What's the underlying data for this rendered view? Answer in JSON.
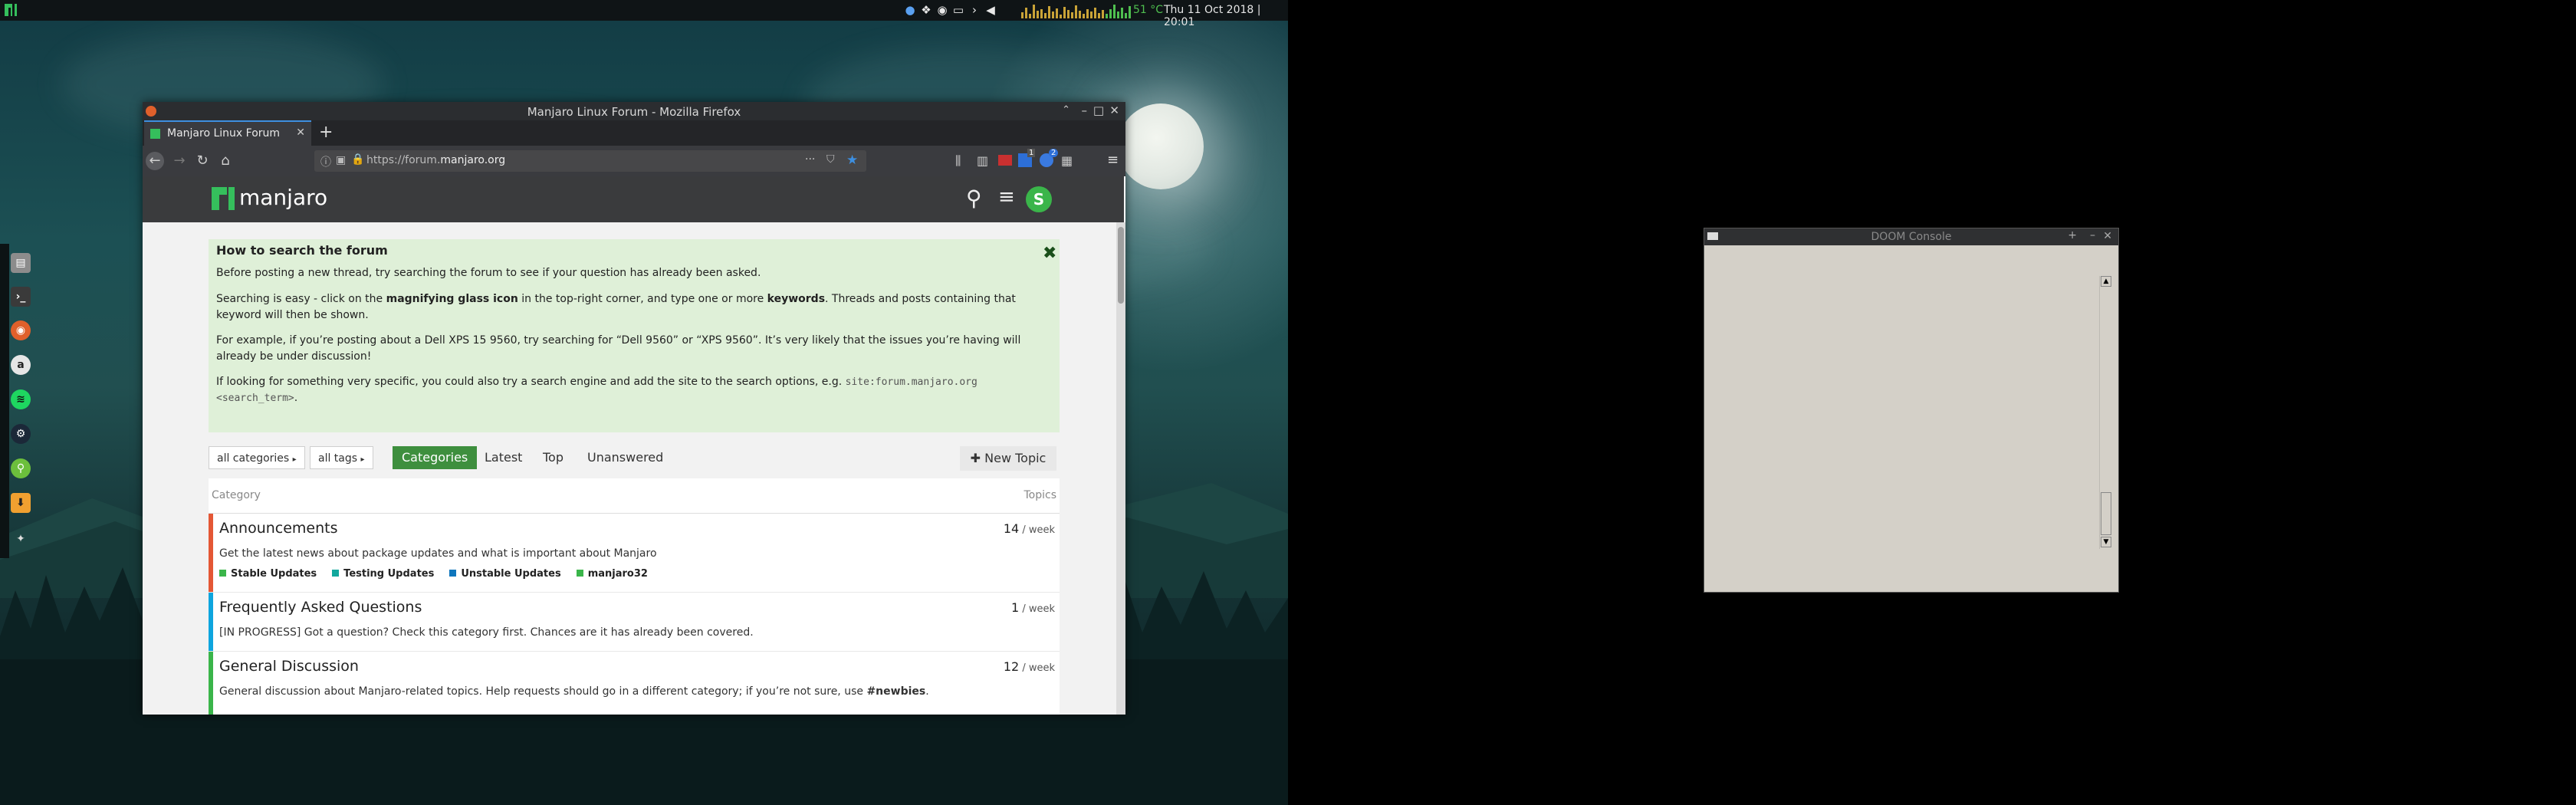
{
  "topbar": {
    "temperature": "51 °C",
    "clock": "Thu 11 Oct 2018 | 20:01"
  },
  "dock": {
    "icons": [
      "file-manager-icon",
      "terminal-icon",
      "firefox-icon",
      "amazon-icon",
      "spotify-icon",
      "steam-icon",
      "keepass-icon",
      "download-icon",
      "settings-icon"
    ]
  },
  "firefox": {
    "window_title": "Manjaro Linux Forum - Mozilla Firefox",
    "tab_title": "Manjaro Linux Forum",
    "new_tab": "+",
    "url_prefix": "https://forum.",
    "url_domain": "manjaro.org",
    "url_more": "···",
    "badge_count": "2",
    "badge_other": "1"
  },
  "forum": {
    "logo_text": "manjaro",
    "avatar_letter": "S",
    "banner": {
      "title": "How to search the forum",
      "p1": "Before posting a new thread, try searching the forum to see if your question has already been asked.",
      "p2_a": "Searching is easy - click on the ",
      "p2_b": "magnifying glass icon",
      "p2_c": " in the top-right corner, and type one or more ",
      "p2_d": "keywords",
      "p2_e": ". Threads and posts containing that keyword will then be shown.",
      "p3": "For example, if you’re posting about a Dell XPS 15 9560, try searching for “Dell 9560” or “XPS 9560”. It’s very likely that the issues you’re having will already be under discussion!",
      "p4_a": "If looking for something very specific, you could also try a search engine and add the site to the search options, e.g. ",
      "p4_code1": "site:forum.manjaro.org",
      "p4_code2": "<search_term>",
      "p4_end": "."
    },
    "filters": {
      "all_categories": "all categories",
      "all_tags": "all tags"
    },
    "nav": {
      "categories": "Categories",
      "latest": "Latest",
      "top": "Top",
      "unanswered": "Unanswered",
      "new_topic": "New Topic"
    },
    "table": {
      "col_category": "Category",
      "col_topics": "Topics",
      "rows": [
        {
          "title": "Announcements",
          "desc": "Get the latest news about package updates and what is important about Manjaro",
          "count": "14",
          "per": " / week",
          "color": "#e45735",
          "subs": [
            {
              "label": "Stable Updates",
              "color": "#3ab54a"
            },
            {
              "label": "Testing Updates",
              "color": "#12a89d"
            },
            {
              "label": "Unstable Updates",
              "color": "#0e76bd"
            },
            {
              "label": "manjaro32",
              "color": "#3ab54a"
            }
          ]
        },
        {
          "title": "Frequently Asked Questions",
          "desc": "[IN PROGRESS] Got a question? Check this category first. Chances are it has already been covered.",
          "count": "1",
          "per": " / week",
          "color": "#0ea5de"
        },
        {
          "title": "General Discussion",
          "desc_a": "General discussion about Manjaro-related topics. Help requests should go in a different category; if you’re not sure, use ",
          "desc_b": "#newbies",
          "desc_c": ".",
          "count": "12",
          "per": " / week",
          "color": "#3ab54a"
        }
      ]
    }
  },
  "doom": {
    "title": "DOOM Console",
    "min": "–",
    "max": "+",
    "close": "✕"
  }
}
